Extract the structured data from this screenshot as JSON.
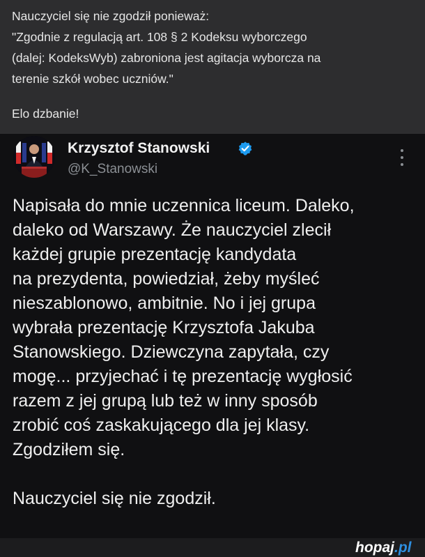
{
  "comment": {
    "lines": [
      "Nauczyciel się nie zgodził ponieważ:",
      "\"Zgodnie z regulacją art. 108 § 2 Kodeksu wyborczego",
      "(dalej: KodeksWyb) zabroniona jest agitacja wyborcza na",
      "terenie szkół wobec uczniów.\"",
      "Elo dzbanie!"
    ]
  },
  "tweet": {
    "author": {
      "display_name": "Krzysztof Stanowski",
      "handle": "@K_Stanowski",
      "verified_icon": "verified-badge-icon",
      "avatar": "avatar-photo"
    },
    "more_icon": "more-vertical-icon",
    "lines": [
      "Napisała do mnie uczennica liceum. Daleko,",
      "daleko od Warszawy. Że nauczyciel zlecił",
      "każdej grupie prezentację kandydata",
      "na prezydenta, powiedział, żeby myśleć",
      "nieszablonowo, ambitnie. No i jej grupa",
      "wybrała prezentację Krzysztofa Jakuba",
      "Stanowskiego. Dziewczyna zapytała, czy",
      "mogę... przyjechać i tę prezentację wygłosić",
      "razem z jej grupą lub też w inny sposób",
      "zrobić coś zaskakującego dla jej klasy.",
      "Zgodziłem się.",
      "Nauczyciel się nie zgodził."
    ]
  },
  "watermark": {
    "name": "hopaj",
    "dot": ".",
    "tld": "pl"
  },
  "colors": {
    "comment_bg": "#2d2d2f",
    "tweet_bg": "#101012",
    "verified": "#1d9bf0",
    "watermark_accent": "#2e8fe0"
  }
}
